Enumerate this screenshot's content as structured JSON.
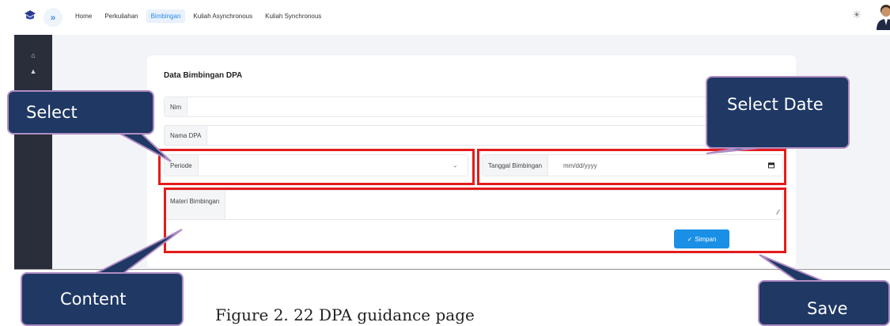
{
  "nav": {
    "items": [
      {
        "label": "Home",
        "active": false
      },
      {
        "label": "Perkuliahan",
        "active": false
      },
      {
        "label": "Bimbingan",
        "active": true
      },
      {
        "label": "Kuliah Asynchronous",
        "active": false
      },
      {
        "label": "Kuliah Synchronous",
        "active": false
      }
    ],
    "expand_glyph": "»",
    "theme_icon": "sun-icon"
  },
  "sidebar": {
    "icons": [
      "home-icon",
      "graduation-cap-icon"
    ]
  },
  "form": {
    "title": "Data Bimbingan DPA",
    "nim_label": "Nim",
    "nim_value": "",
    "nama_dpa_label": "Nama DPA",
    "nama_dpa_value": "",
    "periode_label": "Periode",
    "periode_value": "",
    "tanggal_label": "Tanggal Bimbingan",
    "tanggal_placeholder": "mm/dd/yyyy",
    "materi_label": "Materi Bimbingan",
    "materi_value": "",
    "save_label": "Simpan"
  },
  "annotations": {
    "select": "Select",
    "select_date": "Select Date",
    "content": "Content",
    "save": "Save",
    "highlight_color": "#e41b1b",
    "callout_color": "#1f3864"
  },
  "caption": "Figure 2. 22 DPA guidance page"
}
